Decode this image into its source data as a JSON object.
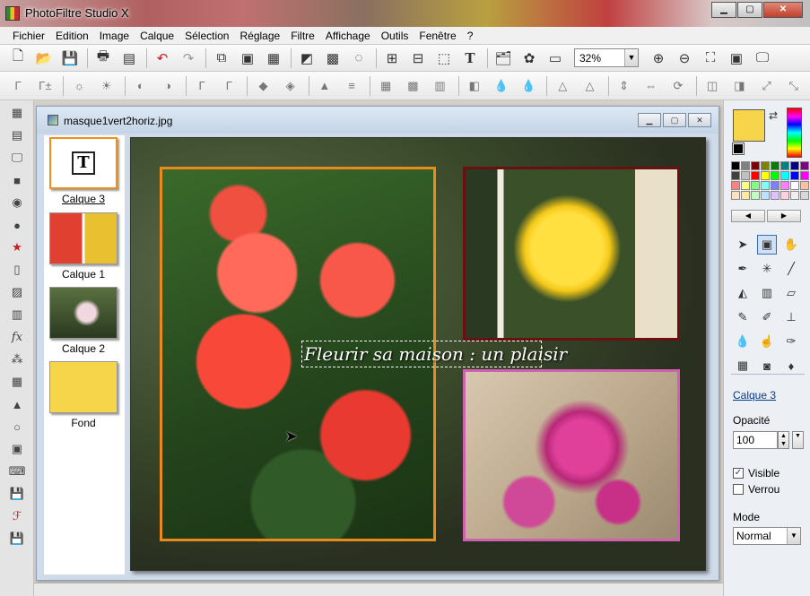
{
  "window": {
    "title": "PhotoFiltre Studio X"
  },
  "menu": [
    "Fichier",
    "Edition",
    "Image",
    "Calque",
    "Sélection",
    "Réglage",
    "Filtre",
    "Affichage",
    "Outils",
    "Fenêtre",
    "?"
  ],
  "toolbar": {
    "zoom_value": "32%"
  },
  "document": {
    "filename": "masque1vert2horiz.jpg"
  },
  "layers": [
    {
      "label": "Calque 3",
      "active": true
    },
    {
      "label": "Calque 1",
      "active": false
    },
    {
      "label": "Calque 2",
      "active": false
    },
    {
      "label": "Fond",
      "active": false
    }
  ],
  "canvas": {
    "text": "Fleurir sa maison : un plaisir"
  },
  "panel": {
    "layer_link": "Calque 3",
    "opacity_label": "Opacité",
    "opacity_value": "100",
    "visible_label": "Visible",
    "visible_checked": true,
    "lock_label": "Verrou",
    "lock_checked": false,
    "mode_label": "Mode",
    "mode_value": "Normal"
  },
  "colors": {
    "foreground": "#f7d54a",
    "background": "#000000",
    "palette": [
      "#000000",
      "#808080",
      "#800000",
      "#808000",
      "#008000",
      "#008080",
      "#000080",
      "#800080",
      "#404040",
      "#c0c0c0",
      "#ff0000",
      "#ffff00",
      "#00ff00",
      "#00ffff",
      "#0000ff",
      "#ff00ff",
      "#ff8080",
      "#ffff80",
      "#80ff80",
      "#80ffff",
      "#8080ff",
      "#ff80ff",
      "#ffffff",
      "#ffc0a0",
      "#ffe0c0",
      "#ffe8a0",
      "#c0ffc0",
      "#c0e0ff",
      "#e0c0ff",
      "#ffd0e0",
      "#f0f0f0",
      "#d8d8d8"
    ]
  }
}
